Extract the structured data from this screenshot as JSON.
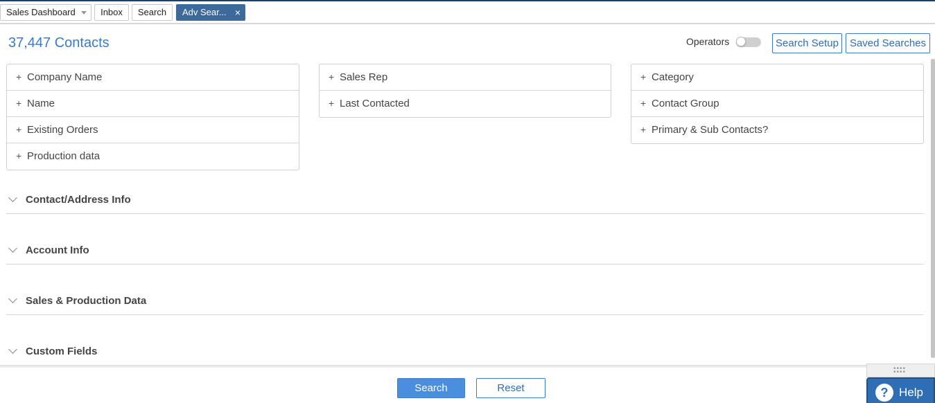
{
  "tabs": {
    "dashboard": "Sales Dashboard",
    "inbox": "Inbox",
    "search": "Search",
    "advanced": "Adv Sear...",
    "close": "×"
  },
  "header": {
    "count": "37,447 Contacts",
    "operators_label": "Operators",
    "operators_on": false,
    "search_setup": "Search Setup",
    "saved_searches": "Saved Searches"
  },
  "filters": {
    "col1": [
      "Company Name",
      "Name",
      "Existing Orders",
      "Production data"
    ],
    "col2": [
      "Sales Rep",
      "Last Contacted"
    ],
    "col3": [
      "Category",
      "Contact Group",
      "Primary & Sub Contacts?"
    ]
  },
  "filter_prefix": "+",
  "sections": [
    "Contact/Address Info",
    "Account Info",
    "Sales & Production Data",
    "Custom Fields"
  ],
  "footer": {
    "search": "Search",
    "reset": "Reset"
  },
  "help": {
    "label": "Help",
    "icon": "?"
  },
  "colors": {
    "accent": "#3a7bc8",
    "active_tab": "#3d6a9a",
    "help": "#2f6db5"
  }
}
